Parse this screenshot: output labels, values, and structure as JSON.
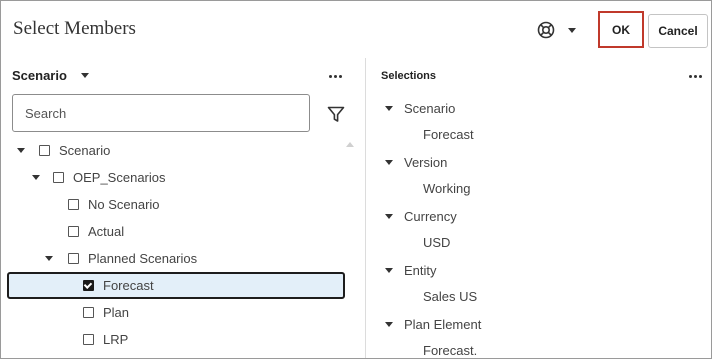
{
  "dialog": {
    "title": "Select Members",
    "ok_label": "OK",
    "cancel_label": "Cancel",
    "help_icon": "lifebuoy-icon"
  },
  "left_pane": {
    "dimension": "Scenario",
    "search_placeholder": "Search",
    "tree": [
      {
        "label": "Scenario",
        "level": 0,
        "expanded": true,
        "checked": false
      },
      {
        "label": "OEP_Scenarios",
        "level": 1,
        "expanded": true,
        "checked": false
      },
      {
        "label": "No Scenario",
        "level": 2,
        "checked": false
      },
      {
        "label": "Actual",
        "level": 2,
        "checked": false
      },
      {
        "label": "Planned Scenarios",
        "level": 2,
        "expanded": true,
        "checked": false
      },
      {
        "label": "Forecast",
        "level": 3,
        "checked": true,
        "selected": true
      },
      {
        "label": "Plan",
        "level": 3,
        "checked": false
      },
      {
        "label": "LRP",
        "level": 3,
        "checked": false
      }
    ]
  },
  "right_pane": {
    "title": "Selections",
    "items": [
      {
        "dimension": "Scenario",
        "member": "Forecast"
      },
      {
        "dimension": "Version",
        "member": "Working"
      },
      {
        "dimension": "Currency",
        "member": "USD"
      },
      {
        "dimension": "Entity",
        "member": "Sales US"
      },
      {
        "dimension": "Plan Element",
        "member": "Forecast."
      }
    ]
  },
  "colors": {
    "ok_border": "#c0392b",
    "selected_row_bg": "#e3eff9"
  }
}
